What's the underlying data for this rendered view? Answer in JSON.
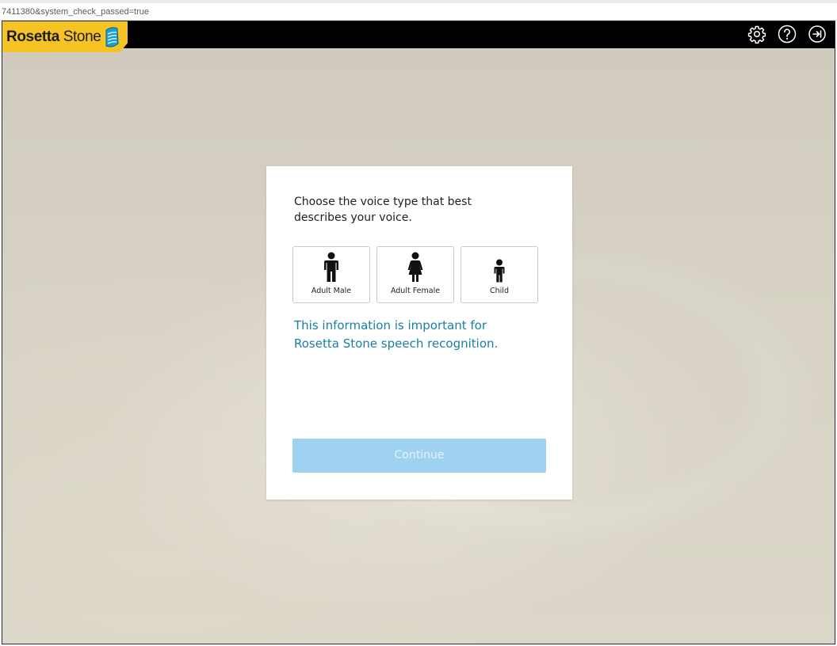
{
  "browser": {
    "url": "7411380&system_check_passed=true"
  },
  "header": {
    "logo_bold": "Rosetta",
    "logo_light": " Stone",
    "icons": [
      "gear-icon",
      "help-icon",
      "sign-out-icon"
    ]
  },
  "dialog": {
    "prompt": "Choose the voice type that best describes your voice.",
    "options": [
      {
        "label": "Adult Male",
        "icon": "adult-male-icon"
      },
      {
        "label": "Adult Female",
        "icon": "adult-female-icon"
      },
      {
        "label": "Child",
        "icon": "child-icon"
      }
    ],
    "info": "This information is important for Rosetta Stone speech recognition.",
    "continue_label": "Continue"
  },
  "colors": {
    "brand_yellow": "#f6c324",
    "info_text": "#1a7fa0",
    "button_disabled": "#9ed2f0",
    "topbar": "#000000"
  }
}
